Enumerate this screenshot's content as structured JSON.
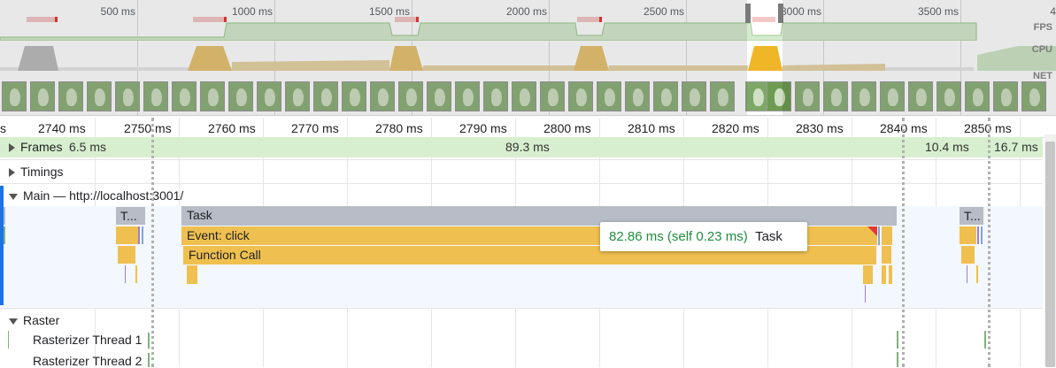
{
  "overview": {
    "tick_labels": [
      "500 ms",
      "1000 ms",
      "1500 ms",
      "2000 ms",
      "2500 ms",
      "3000 ms",
      "3500 ms",
      "4"
    ],
    "lanes": {
      "fps": "FPS",
      "cpu": "CPU",
      "net": "NET"
    }
  },
  "ruler": {
    "tick_labels": [
      "s",
      "2740 ms",
      "2750 ms",
      "2760 ms",
      "2770 ms",
      "2780 ms",
      "2790 ms",
      "2800 ms",
      "2810 ms",
      "2820 ms",
      "2830 ms",
      "2840 ms",
      "2850 ms"
    ]
  },
  "tracks": {
    "frames": {
      "title": "Frames",
      "durations": [
        "6.5 ms",
        "89.3 ms",
        "10.4 ms",
        "16.7 ms"
      ]
    },
    "timings": {
      "title": "Timings"
    },
    "main": {
      "title": "Main — http://localhost:3001/"
    },
    "raster": {
      "title": "Raster",
      "threads": [
        "Rasterizer Thread 1",
        "Rasterizer Thread 2"
      ]
    }
  },
  "flame": {
    "task_short_1": "T...",
    "task": "Task",
    "event": "Event: click",
    "function": "Function Call",
    "task_short_2": "T..."
  },
  "tooltip": {
    "duration": "82.86 ms (self 0.23 ms)",
    "name": "Task"
  },
  "colors": {
    "task": "#b7bcc6",
    "scripting": "#efc04f",
    "frames": "#d7efce",
    "tooltip_duration": "#1e8e3e",
    "selection": "#1a73e8"
  }
}
